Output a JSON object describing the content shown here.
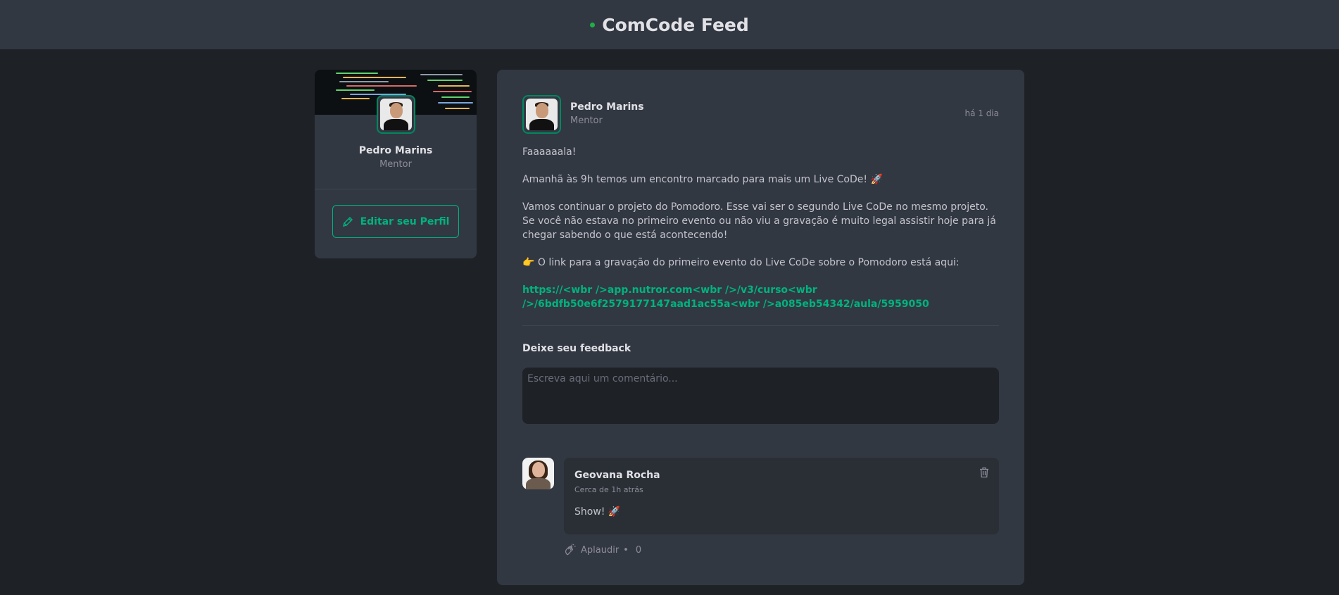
{
  "header": {
    "title": "ComCode Feed"
  },
  "sidebar": {
    "name": "Pedro Marins",
    "role": "Mentor",
    "edit_label": "Editar seu Perfil"
  },
  "post": {
    "author": {
      "name": "Pedro Marins",
      "role": "Mentor"
    },
    "time": "há 1 dia",
    "paragraphs": [
      "Faaaaaala!",
      "Amanhã às 9h temos um encontro marcado para mais um Live CoDe! 🚀",
      "Vamos continuar o projeto do Pomodoro. Esse vai ser o segundo Live CoDe no mesmo projeto. Se você não estava no primeiro evento ou não viu a gravação é muito legal assistir hoje para já chegar sabendo o que está acontecendo!",
      "👉 O link para a gravação do primeiro evento do Live CoDe sobre o Pomodoro está aqui:"
    ],
    "link": "https://<wbr />app.nutror.com<wbr />/v3/curso<wbr />/6bdfb50e6f2579177147aad1ac55a<wbr />a085eb54342/aula/5959050",
    "feedback_label": "Deixe seu feedback",
    "comment_placeholder": "Escreva aqui um comentário..."
  },
  "comment": {
    "author": "Geovana Rocha",
    "time": "Cerca de 1h atrás",
    "text": "Show! 🚀",
    "applaud_label": "Aplaudir",
    "applaud_separator": "•",
    "applaud_count": "0"
  },
  "icons": {
    "edit": "pencil-icon",
    "trash": "trash-icon",
    "applaud": "hands-clapping-icon"
  },
  "colors": {
    "accent": "#00b37e",
    "header_bg": "#323842",
    "page_bg": "#1e2227"
  }
}
